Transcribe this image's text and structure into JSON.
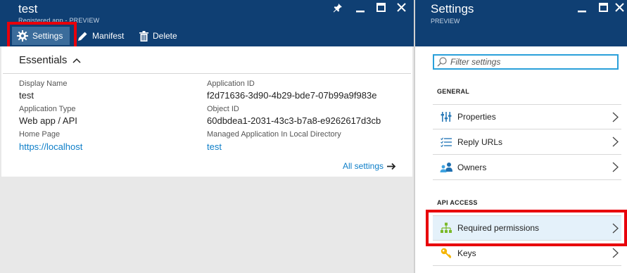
{
  "left_blade": {
    "title": "test",
    "subtitle": "Registered app - PREVIEW",
    "commands": [
      {
        "label": "Settings",
        "icon": "gear-icon"
      },
      {
        "label": "Manifest",
        "icon": "pencil-icon"
      },
      {
        "label": "Delete",
        "icon": "trash-icon"
      }
    ],
    "window_controls": [
      "pin-icon",
      "minimize-icon",
      "maximize-icon",
      "close-icon"
    ],
    "essentials": {
      "heading": "Essentials",
      "fields": {
        "display_name": {
          "label": "Display Name",
          "value": "test"
        },
        "application_type": {
          "label": "Application Type",
          "value": "Web app / API"
        },
        "home_page": {
          "label": "Home Page",
          "value": "https://localhost"
        },
        "application_id": {
          "label": "Application ID",
          "value": "f2d71636-3d90-4b29-bde7-07b99a9f983e"
        },
        "object_id": {
          "label": "Object ID",
          "value": "60dbdea1-2031-43c3-b7a8-e9262617d3cb"
        },
        "managed_app": {
          "label": "Managed Application In Local Directory",
          "value": "test"
        }
      },
      "all_settings": "All settings"
    }
  },
  "right_blade": {
    "title": "Settings",
    "subtitle": "PREVIEW",
    "window_controls": [
      "minimize-icon",
      "maximize-icon",
      "close-icon"
    ],
    "filter_placeholder": "Filter settings",
    "sections": [
      {
        "heading": "GENERAL",
        "items": [
          {
            "label": "Properties",
            "icon": "properties-icon"
          },
          {
            "label": "Reply URLs",
            "icon": "list-icon"
          },
          {
            "label": "Owners",
            "icon": "owners-icon"
          }
        ]
      },
      {
        "heading": "API ACCESS",
        "items": [
          {
            "label": "Required permissions",
            "icon": "hierarchy-icon",
            "selected": true
          },
          {
            "label": "Keys",
            "icon": "key-icon"
          }
        ]
      }
    ]
  },
  "colors": {
    "header_bg": "#0f3f73",
    "link": "#0d7ec8",
    "highlight_box": "#e8000b",
    "filter_border": "#2aa0da",
    "selected_row_bg": "#e4f1fa"
  }
}
